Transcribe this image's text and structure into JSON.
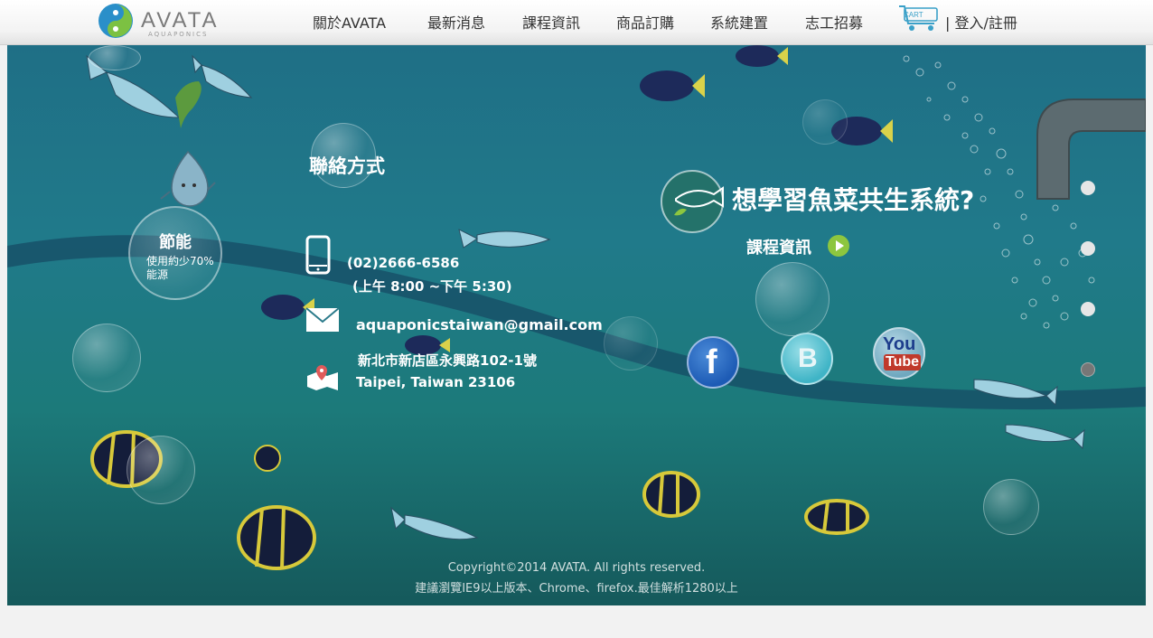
{
  "brand": {
    "name": "AVATA",
    "tagline": "AQUAPONICS"
  },
  "nav": {
    "items": [
      "關於AVATA",
      "最新消息",
      "課程資訊",
      "商品訂購",
      "系統建置",
      "志工招募"
    ],
    "cart_label": "CART",
    "login_label": "| 登入/註冊"
  },
  "energy": {
    "title": "節能",
    "desc": "使用約少70%能源"
  },
  "contact": {
    "title": "聯絡方式",
    "phone": "(02)2666-6586",
    "hours": "(上午 8:00 ~下午 5:30)",
    "email": "aquaponicstaiwan@gmail.com",
    "address_zh": "新北市新店區永興路102-1號",
    "address_en": "Taipei, Taiwan 23106"
  },
  "promo": {
    "title": "想學習魚菜共生系統?",
    "link_label": "課程資訊"
  },
  "social": {
    "facebook": "f",
    "blogger": "B",
    "youtube_top": "You",
    "youtube_bottom": "Tube"
  },
  "slider": {
    "active_index": 4,
    "count": 4
  },
  "footer": {
    "copyright": "Copyright©2014 AVATA. All rights reserved.",
    "note": "建議瀏覽IE9以上版本、Chrome、firefox.最佳解析1280以上"
  },
  "colors": {
    "water_top": "#1f6f86",
    "water_bottom": "#15595b",
    "accent_green": "#8dc63f",
    "fish_blue": "#9fd0e0"
  }
}
